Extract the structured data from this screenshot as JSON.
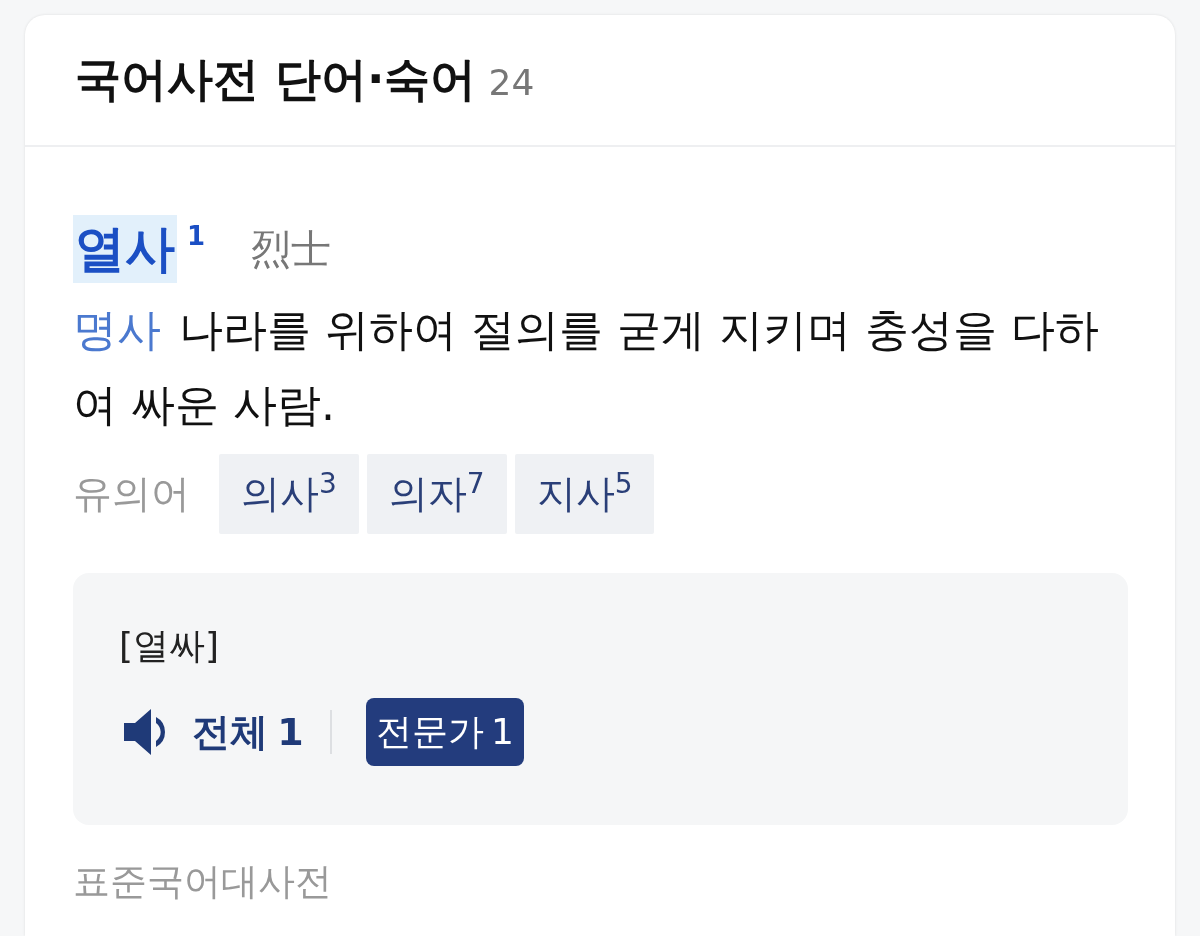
{
  "header": {
    "title": "국어사전 단어·숙어",
    "count": "24"
  },
  "entry": {
    "headword": "열사",
    "homonym_number": "1",
    "highlighted": true,
    "hanja": "烈士",
    "part_of_speech": "명사",
    "definition": "나라를 위하여 절의를 굳게 지키며 충성을 다하여 싸운 사람.",
    "synonyms_label": "유의어",
    "synonyms": [
      "의사$^{3}$",
      "의자$^{7}$",
      "지사$^{5}$"
    ],
    "pronunciation": {
      "text": "[열싸]",
      "play_label": "전체 1",
      "badge": "전문가 1"
    },
    "source": "표준국어대사전"
  }
}
